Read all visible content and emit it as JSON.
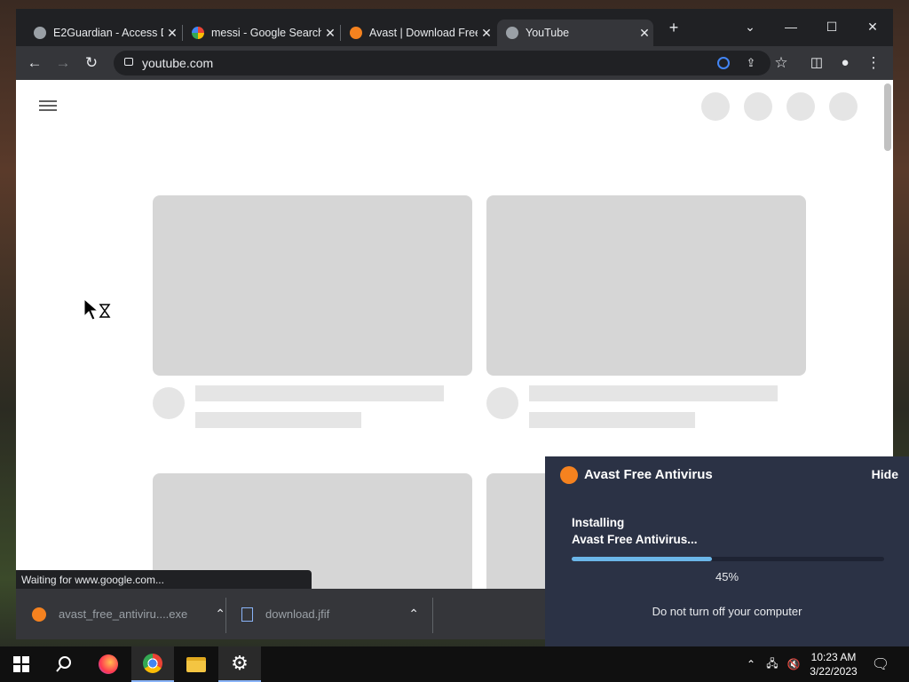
{
  "browser": {
    "tabs": [
      {
        "label": "E2Guardian - Access D",
        "icon": "globe-icon"
      },
      {
        "label": "messi - Google Search",
        "icon": "google-icon"
      },
      {
        "label": "Avast | Download Free",
        "icon": "avast-icon"
      },
      {
        "label": "YouTube",
        "icon": "globe-icon"
      }
    ],
    "url": "youtube.com",
    "status_text": "Waiting for www.google.com...",
    "downloads": [
      {
        "name": "avast_free_antiviru....exe",
        "icon": "avast-icon"
      },
      {
        "name": "download.jfif",
        "icon": "file-icon"
      }
    ]
  },
  "avast_popup": {
    "title": "Avast Free Antivirus",
    "hide_label": "Hide",
    "status_line1": "Installing",
    "status_line2": "Avast Free Antivirus...",
    "progress_fraction": 0.45,
    "progress_label": "45%",
    "warning": "Do not turn off your computer"
  },
  "taskbar": {
    "time": "10:23 AM",
    "date": "3/22/2023"
  },
  "colors": {
    "avast_orange": "#f5821f",
    "avast_panel": "#2b3245",
    "chrome_dark": "#202124",
    "progress": "#6bb6e8"
  }
}
